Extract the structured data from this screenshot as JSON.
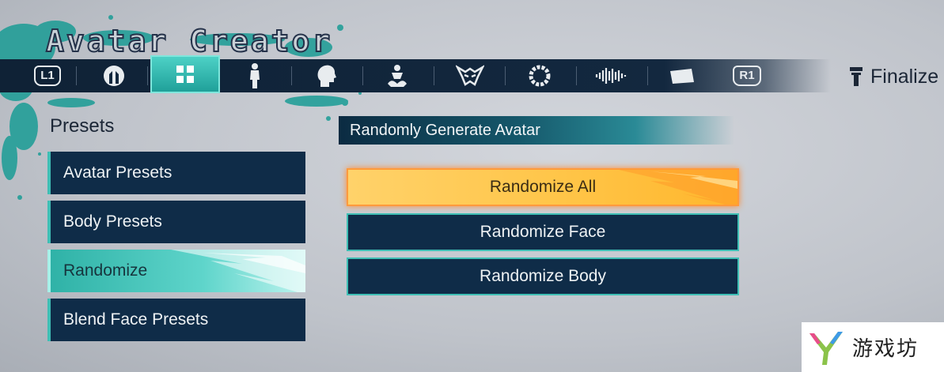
{
  "app": {
    "title": "Avatar Creator"
  },
  "tabbar": {
    "left_bumper": "L1",
    "right_bumper": "R1",
    "tabs": [
      {
        "icon": "face-preset-icon",
        "active": false
      },
      {
        "icon": "grid-presets-icon",
        "active": true
      },
      {
        "icon": "body-icon",
        "active": false
      },
      {
        "icon": "head-profile-icon",
        "active": false
      },
      {
        "icon": "outfit-icon",
        "active": false
      },
      {
        "icon": "mask-icon",
        "active": false
      },
      {
        "icon": "ring-icon",
        "active": false
      },
      {
        "icon": "voice-wave-icon",
        "active": false
      },
      {
        "icon": "card-icon",
        "active": false
      }
    ],
    "finalize_label": "Finalize"
  },
  "left_menu": {
    "title": "Presets",
    "items": [
      {
        "label": "Avatar Presets",
        "selected": false
      },
      {
        "label": "Body Presets",
        "selected": false
      },
      {
        "label": "Randomize",
        "selected": true
      },
      {
        "label": "Blend Face Presets",
        "selected": false
      }
    ]
  },
  "right_panel": {
    "header": "Randomly Generate Avatar",
    "buttons": [
      {
        "label": "Randomize All",
        "highlighted": true
      },
      {
        "label": "Randomize Face",
        "highlighted": false
      },
      {
        "label": "Randomize Body",
        "highlighted": false
      }
    ]
  },
  "watermark": {
    "text": "游戏坊"
  },
  "colors": {
    "accent_teal": "#3fbfb5",
    "panel_navy": "#0f2c48",
    "highlight_orange": "#ffc548",
    "background_gray": "#c4c8ce"
  }
}
